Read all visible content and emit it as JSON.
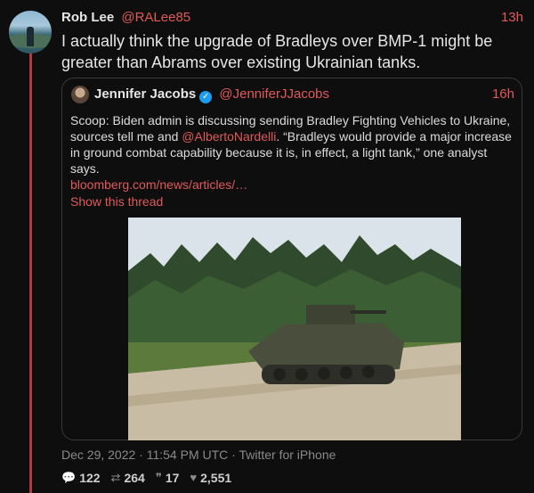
{
  "tweet": {
    "author_name": "Rob Lee",
    "author_handle": "@RALee85",
    "time": "13h",
    "text": "I actually think the upgrade of Bradleys over BMP-1 might be greater than Abrams over existing Ukrainian tanks."
  },
  "quote": {
    "author_name": "Jennifer Jacobs",
    "verified_icon": "verified-badge-icon",
    "author_handle": "@JenniferJJacobs",
    "time": "16h",
    "text_before": "Scoop: Biden admin is discussing sending Bradley Fighting Vehicles to Ukraine, sources tell me and ",
    "mention": "@AlbertoNardelli",
    "text_after": ". “Bradleys would provide a major increase in ground combat capability because it is, in effect, a light tank,” one analyst says.",
    "link": "bloomberg.com/news/articles/…",
    "show_thread": "Show this thread"
  },
  "meta": {
    "timestamp": "Dec 29, 2022 · 11:54 PM UTC · Twitter for iPhone"
  },
  "stats": {
    "replies": "122",
    "retweets": "264",
    "quotes": "17",
    "likes": "2,551"
  },
  "colors": {
    "accent": "#e05a5a",
    "background": "#0e0e0e",
    "thread_line": "#b33a3a"
  }
}
